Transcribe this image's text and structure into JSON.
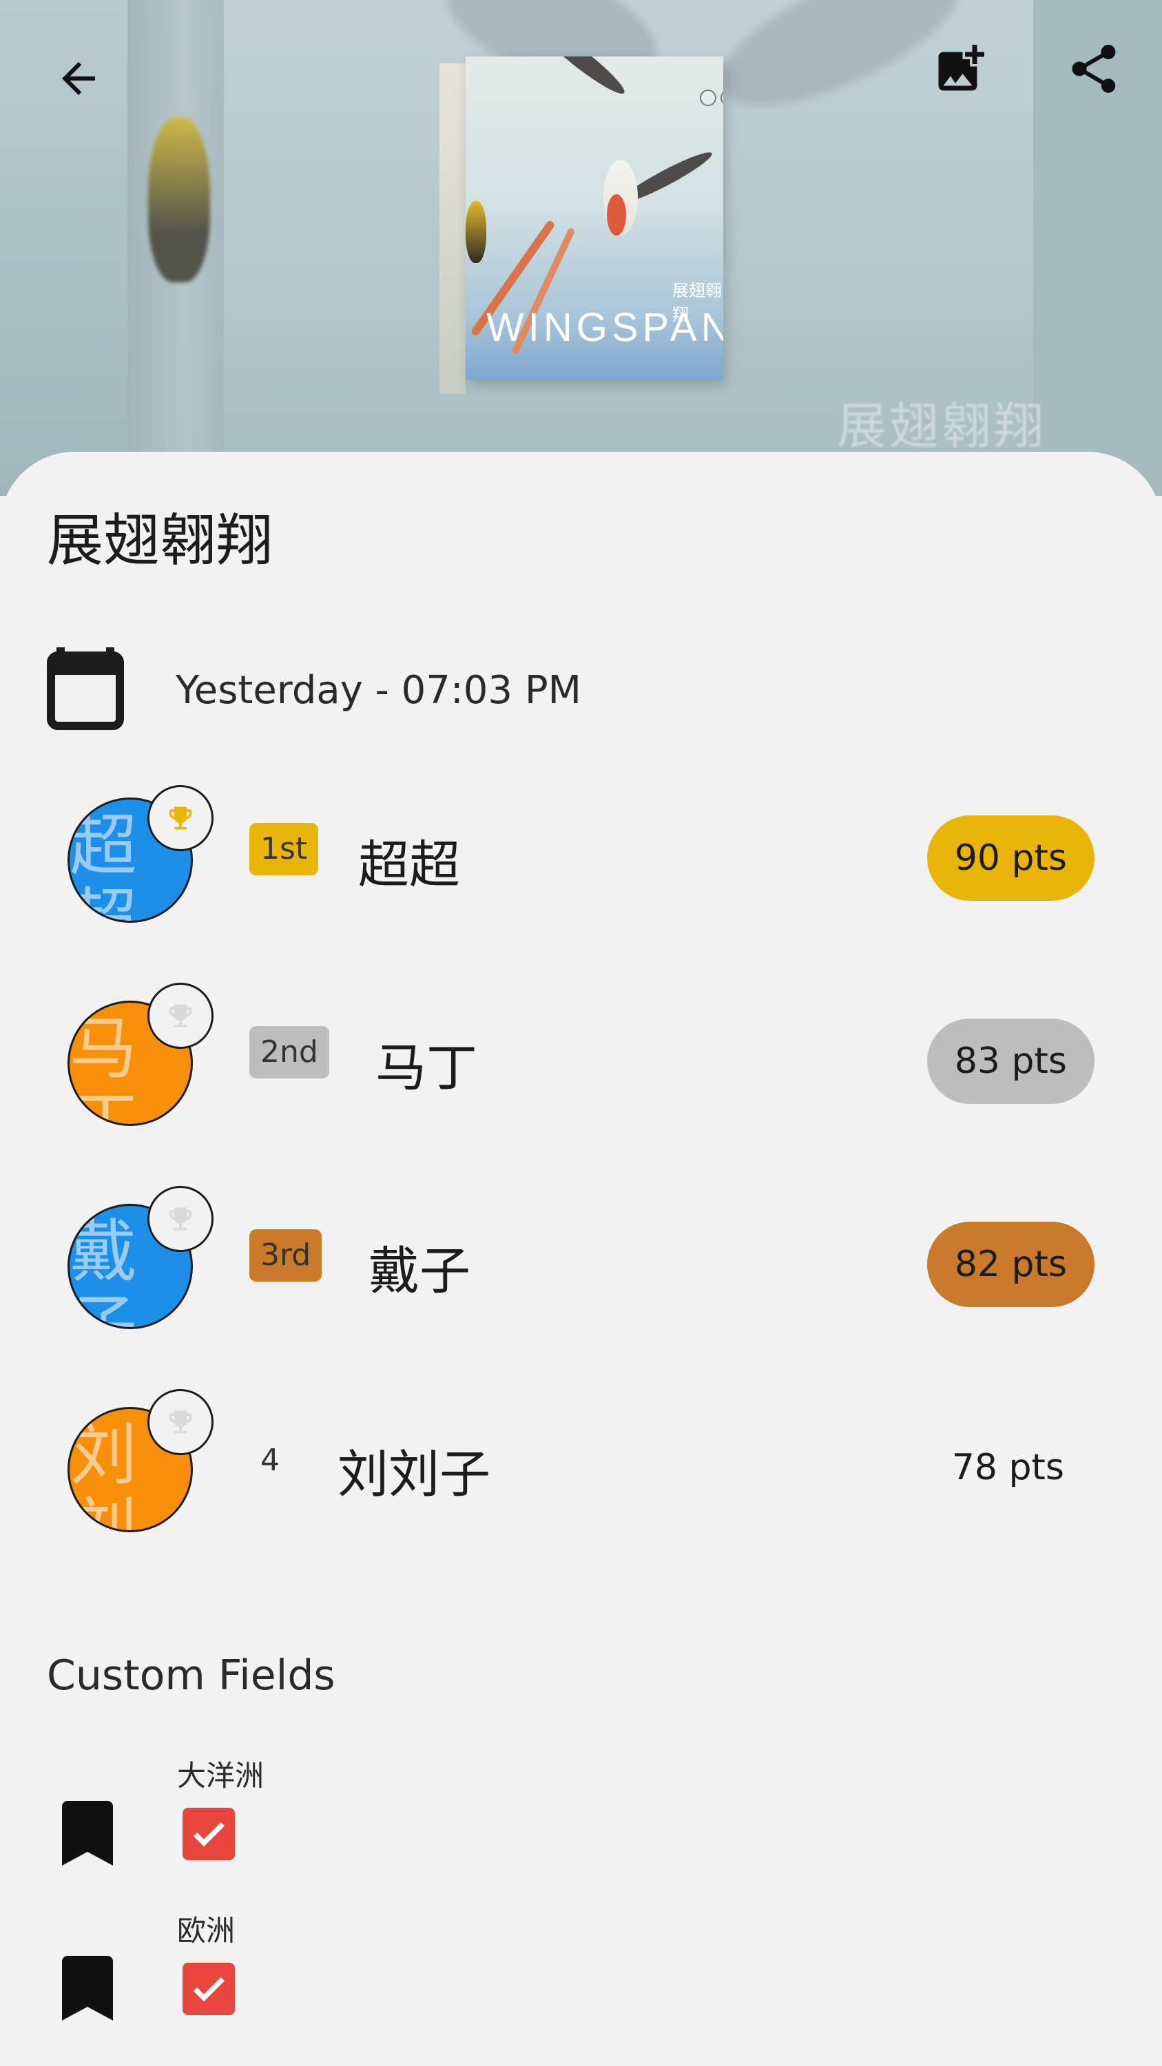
{
  "header": {
    "back_icon": "arrow-left-icon",
    "add_photo_icon": "add-photo-icon",
    "share_icon": "share-icon",
    "box_title": "WINGSPAN",
    "box_cn": "展翅翱翔",
    "bg_watermark": "展翅翱翔"
  },
  "game": {
    "title": "展翅翱翔",
    "date": "Yesterday - 07:03 PM",
    "calendar_icon": "calendar-icon"
  },
  "colors": {
    "gold": "#e9b50b",
    "silver": "#bdbdbd",
    "bronze": "#c97a2b",
    "avatar_blue": "#1e8fe8",
    "avatar_orange": "#f78f0a",
    "check_red": "#e8453c"
  },
  "players": [
    {
      "avatar_text": "超\n超",
      "rank": "1st",
      "name": "超超",
      "points": "90 pts",
      "avatar_color": "#1e8fe8",
      "trophy": "gold"
    },
    {
      "avatar_text": "马\n丁",
      "rank": "2nd",
      "name": "马丁",
      "points": "83 pts",
      "avatar_color": "#f78f0a",
      "trophy": "grey"
    },
    {
      "avatar_text": "戴\n子",
      "rank": "3rd",
      "name": "戴子",
      "points": "82 pts",
      "avatar_color": "#1e8fe8",
      "trophy": "grey"
    },
    {
      "avatar_text": "刘\n刘",
      "rank": "4",
      "name": "刘刘子",
      "points": "78 pts",
      "avatar_color": "#f78f0a",
      "trophy": "grey"
    }
  ],
  "custom_fields": {
    "title": "Custom Fields",
    "items": [
      {
        "label": "大洋洲",
        "checked": true,
        "icon": "bookmark-icon"
      },
      {
        "label": "欧洲",
        "checked": true,
        "icon": "bookmark-icon"
      }
    ]
  }
}
